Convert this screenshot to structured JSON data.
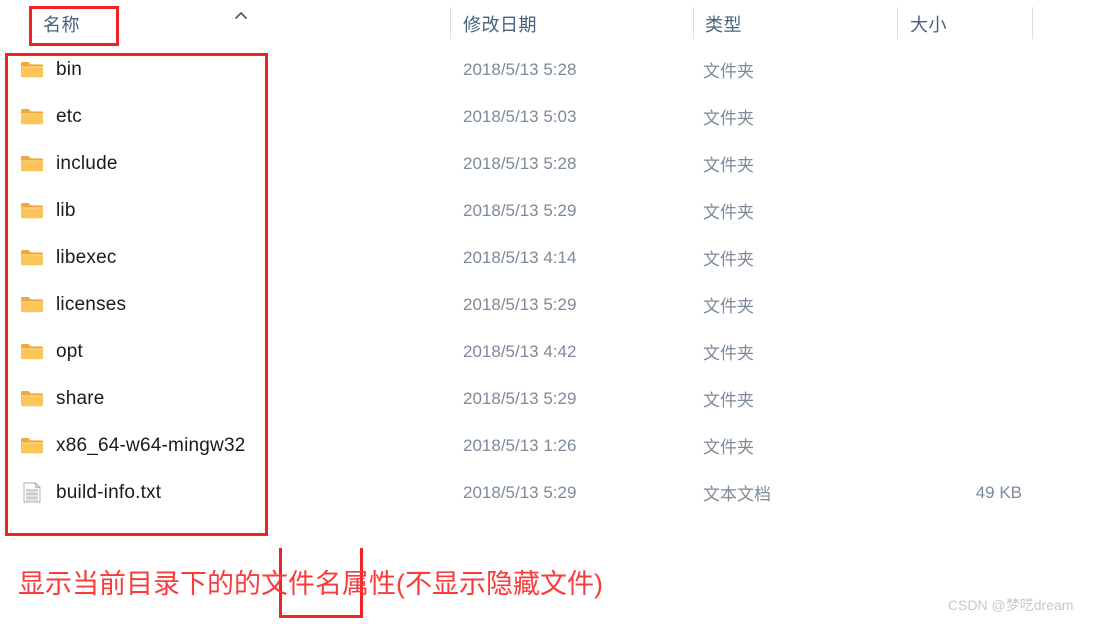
{
  "columns": {
    "name": "名称",
    "date_modified": "修改日期",
    "type": "类型",
    "size": "大小",
    "sort_indicator": "chevron-up-icon"
  },
  "files": [
    {
      "name": "bin",
      "icon": "folder-icon",
      "date": "2018/5/13 5:28",
      "type": "文件夹",
      "size": ""
    },
    {
      "name": "etc",
      "icon": "folder-icon",
      "date": "2018/5/13 5:03",
      "type": "文件夹",
      "size": ""
    },
    {
      "name": "include",
      "icon": "folder-icon",
      "date": "2018/5/13 5:28",
      "type": "文件夹",
      "size": ""
    },
    {
      "name": "lib",
      "icon": "folder-icon",
      "date": "2018/5/13 5:29",
      "type": "文件夹",
      "size": ""
    },
    {
      "name": "libexec",
      "icon": "folder-icon",
      "date": "2018/5/13 4:14",
      "type": "文件夹",
      "size": ""
    },
    {
      "name": "licenses",
      "icon": "folder-icon",
      "date": "2018/5/13 5:29",
      "type": "文件夹",
      "size": ""
    },
    {
      "name": "opt",
      "icon": "folder-icon",
      "date": "2018/5/13 4:42",
      "type": "文件夹",
      "size": ""
    },
    {
      "name": "share",
      "icon": "folder-icon",
      "date": "2018/5/13 5:29",
      "type": "文件夹",
      "size": ""
    },
    {
      "name": "x86_64-w64-mingw32",
      "icon": "folder-icon",
      "date": "2018/5/13 1:26",
      "type": "文件夹",
      "size": ""
    },
    {
      "name": "build-info.txt",
      "icon": "document-icon",
      "date": "2018/5/13 5:29",
      "type": "文本文档",
      "size": "49 KB"
    }
  ],
  "annotation": {
    "caption": "显示当前目录下的的文件名属性(不显示隐藏文件)",
    "highlight_color": "#ef2323",
    "caption_color": "#fb3b3b"
  },
  "watermark": {
    "text": "CSDN @梦呓dream"
  }
}
